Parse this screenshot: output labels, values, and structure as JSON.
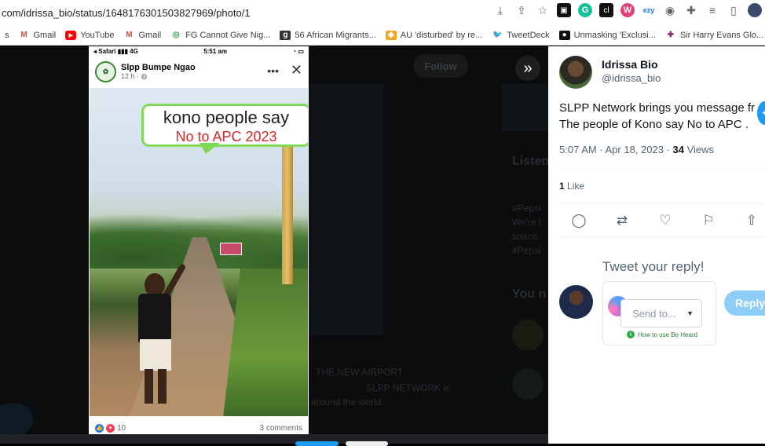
{
  "browser": {
    "url_prefix": "com/idrissa_bio/status/1648176301503827969/photo/1",
    "url_rest": ""
  },
  "bookmarks": [
    {
      "label": "s",
      "icon": ""
    },
    {
      "label": "Gmail",
      "icon": "gmail-icon"
    },
    {
      "label": "YouTube",
      "icon": "youtube-icon"
    },
    {
      "label": "Gmail",
      "icon": "gmail-icon"
    },
    {
      "label": "FG Cannot Give Nig...",
      "icon": "globe-green-icon"
    },
    {
      "label": "56 African Migrants...",
      "icon": "g-news-icon"
    },
    {
      "label": "AU 'disturbed' by re...",
      "icon": "orange-icon"
    },
    {
      "label": "TweetDeck",
      "icon": "twitter-icon"
    },
    {
      "label": "Unmasking 'Exclusi...",
      "icon": "dark-news-icon"
    },
    {
      "label": "Sir Harry Evans Glo...",
      "icon": "crest-icon"
    }
  ],
  "background": {
    "follow_label": "Follow",
    "ghost_lines": [
      "Listen",
      "#Pepsi",
      "We're l",
      "space.",
      "#Pepsi",
      "You n",
      "THE NEW AIRPORT",
      "SLPP NETWORK is",
      "around the world."
    ]
  },
  "fb_post": {
    "status_left": "◂ Safari ▮▮▮ 4G",
    "status_time": "5:51 am",
    "status_right": "◔ ▭",
    "page_name": "Slpp Bumpe Ngao",
    "time": "12 h · ◍",
    "billboard_line1": "kono people say",
    "billboard_line2": "No to APC 2023",
    "reaction_count": "10",
    "comments": "3 comments"
  },
  "tweet": {
    "author_name": "Idrissa Bio",
    "author_handle": "@idrissa_bio",
    "text_line1": "SLPP Network brings you message fr",
    "text_line2": "The people of Kono say No to APC .",
    "time": "5:07 AM · Apr 18, 2023 · ",
    "views_count": "34",
    "views_label": " Views",
    "likes_count": "1",
    "likes_label": " Like",
    "reply_prompt": "Tweet your reply!",
    "send_to_placeholder": "Send to...",
    "be_heard_help": "How to use Be Heard",
    "reply_button": "Reply"
  }
}
